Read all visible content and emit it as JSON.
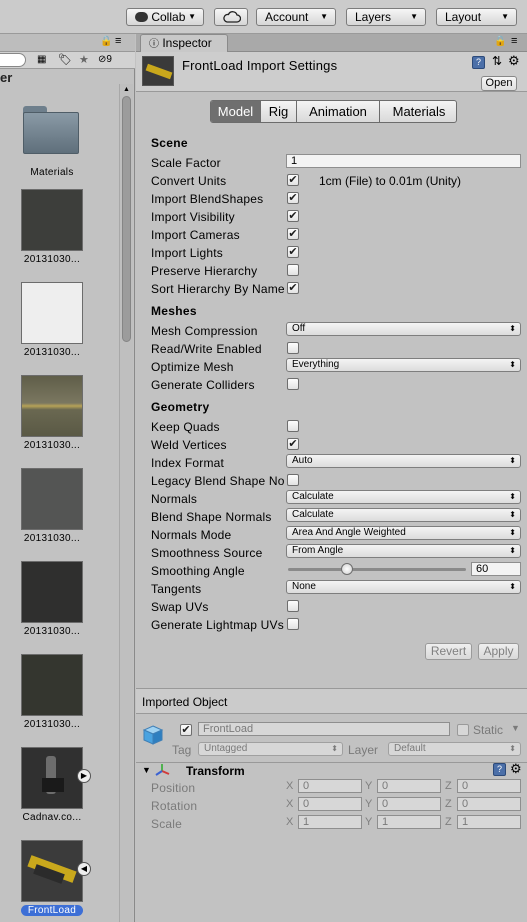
{
  "toolbar": {
    "collab": "Collab",
    "account": "Account",
    "layers": "Layers",
    "layout": "Layout"
  },
  "project": {
    "panel_title_fragment": "er",
    "visible_count": "9",
    "assets": [
      {
        "label": "Materials",
        "kind": "folder"
      },
      {
        "label": "20131030...",
        "kind": "texture",
        "color": "#3d3e3b"
      },
      {
        "label": "20131030...",
        "kind": "texture",
        "color": "#f1f1f1"
      },
      {
        "label": "20131030...",
        "kind": "texture",
        "color": "#6b6a52"
      },
      {
        "label": "20131030...",
        "kind": "texture",
        "color": "#545554"
      },
      {
        "label": "20131030...",
        "kind": "texture",
        "color": "#2f2f2e"
      },
      {
        "label": "20131030...",
        "kind": "texture",
        "color": "#34362f"
      },
      {
        "label": "Cadnav.co...",
        "kind": "model"
      },
      {
        "label": "FrontLoad",
        "kind": "model-selected"
      }
    ]
  },
  "inspector": {
    "tab_label": "Inspector",
    "title": "FrontLoad Import Settings",
    "open_button": "Open",
    "tabs": [
      "Model",
      "Rig",
      "Animation",
      "Materials"
    ],
    "active_tab": "Model",
    "scene": {
      "header": "Scene",
      "scale_factor_label": "Scale Factor",
      "scale_factor_value": "1",
      "convert_units_label": "Convert Units",
      "convert_units_checked": true,
      "convert_units_note": "1cm (File) to 0.01m (Unity)",
      "import_blendshapes_label": "Import BlendShapes",
      "import_blendshapes_checked": true,
      "import_visibility_label": "Import Visibility",
      "import_visibility_checked": true,
      "import_cameras_label": "Import Cameras",
      "import_cameras_checked": true,
      "import_lights_label": "Import Lights",
      "import_lights_checked": true,
      "preserve_hierarchy_label": "Preserve Hierarchy",
      "preserve_hierarchy_checked": false,
      "sort_hierarchy_label": "Sort Hierarchy By Name",
      "sort_hierarchy_checked": true
    },
    "meshes": {
      "header": "Meshes",
      "mesh_compression_label": "Mesh Compression",
      "mesh_compression_value": "Off",
      "read_write_label": "Read/Write Enabled",
      "read_write_checked": false,
      "optimize_mesh_label": "Optimize Mesh",
      "optimize_mesh_value": "Everything",
      "generate_colliders_label": "Generate Colliders",
      "generate_colliders_checked": false
    },
    "geometry": {
      "header": "Geometry",
      "keep_quads_label": "Keep Quads",
      "keep_quads_checked": false,
      "weld_vertices_label": "Weld Vertices",
      "weld_vertices_checked": true,
      "index_format_label": "Index Format",
      "index_format_value": "Auto",
      "legacy_blend_label": "Legacy Blend Shape No",
      "legacy_blend_checked": false,
      "normals_label": "Normals",
      "normals_value": "Calculate",
      "blend_shape_normals_label": "Blend Shape Normals",
      "blend_shape_normals_value": "Calculate",
      "normals_mode_label": "Normals Mode",
      "normals_mode_value": "Area And Angle Weighted",
      "smoothness_source_label": "Smoothness Source",
      "smoothness_source_value": "From Angle",
      "smoothing_angle_label": "Smoothing Angle",
      "smoothing_angle_value": "60",
      "smoothing_angle_fraction": 0.333,
      "tangents_label": "Tangents",
      "tangents_value": "None",
      "swap_uvs_label": "Swap UVs",
      "swap_uvs_checked": false,
      "generate_lightmap_uvs_label": "Generate Lightmap UVs",
      "generate_lightmap_uvs_checked": false
    },
    "revert_button": "Revert",
    "apply_button": "Apply",
    "imported_object": {
      "header": "Imported Object",
      "name_value": "FrontLoad",
      "static_label": "Static",
      "tag_label": "Tag",
      "tag_value": "Untagged",
      "layer_label": "Layer",
      "layer_value": "Default"
    },
    "transform": {
      "header": "Transform",
      "rows": [
        {
          "label": "Position",
          "x": "0",
          "y": "0",
          "z": "0"
        },
        {
          "label": "Rotation",
          "x": "0",
          "y": "0",
          "z": "0"
        },
        {
          "label": "Scale",
          "x": "1",
          "y": "1",
          "z": "1"
        }
      ],
      "axes": [
        "X",
        "Y",
        "Z"
      ]
    }
  },
  "colors": {
    "selection_blue": "#3d6fd6",
    "active_tab_dark": "#6f6f6f"
  }
}
